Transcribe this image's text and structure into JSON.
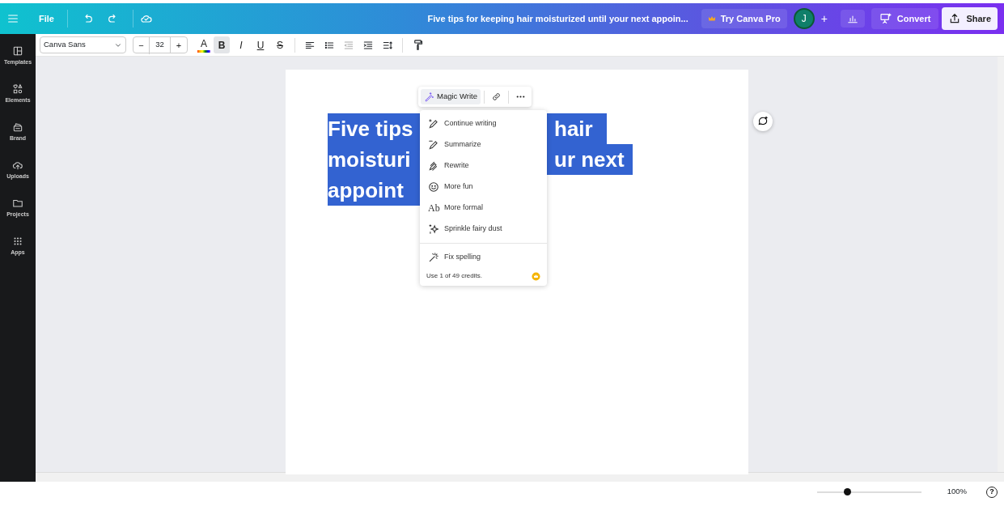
{
  "top_bar": {
    "file_menu": "File",
    "document_title": "Five tips for keeping hair moisturized until your next appoin...",
    "try_pro": "Try Canva Pro",
    "avatar_initial": "J",
    "add_person": "+",
    "convert": "Convert",
    "share": "Share"
  },
  "side_nav": [
    {
      "label": "Templates",
      "kind": "templates"
    },
    {
      "label": "Elements",
      "kind": "elements"
    },
    {
      "label": "Brand",
      "kind": "brand"
    },
    {
      "label": "Uploads",
      "kind": "uploads"
    },
    {
      "label": "Projects",
      "kind": "projects"
    },
    {
      "label": "Apps",
      "kind": "apps"
    }
  ],
  "text_toolbar": {
    "font": "Canva Sans",
    "decrease": "−",
    "size": "32",
    "increase": "+",
    "color_letter": "A",
    "format_buttons": [
      {
        "label": "B",
        "kind": "bold",
        "active": true
      },
      {
        "label": "I",
        "kind": "italic",
        "active": false
      },
      {
        "label": "U",
        "kind": "underline",
        "active": false
      },
      {
        "label": "S",
        "kind": "strike",
        "active": false
      }
    ]
  },
  "canvas": {
    "text_lines": [
      {
        "left": "Five tips",
        "right": "hair"
      },
      {
        "left": "moisturi",
        "right": "ur next"
      },
      {
        "left": "appoint"
      }
    ]
  },
  "magic_toolbar": {
    "label": "Magic Write"
  },
  "magic_menu": {
    "items": [
      {
        "label": "Continue writing",
        "kind": "continue"
      },
      {
        "label": "Summarize",
        "kind": "summarize"
      },
      {
        "label": "Rewrite",
        "kind": "rewrite"
      },
      {
        "label": "More fun",
        "kind": "fun"
      },
      {
        "label": "More formal",
        "kind": "formal",
        "glyph": "Ab"
      },
      {
        "label": "Sprinkle fairy dust",
        "kind": "sparkle"
      },
      {
        "label": "Fix spelling",
        "kind": "fix"
      }
    ],
    "credits": "Use 1 of 49 credits."
  },
  "zoom": {
    "level": 0.29,
    "reading": "100%"
  },
  "help": "?"
}
